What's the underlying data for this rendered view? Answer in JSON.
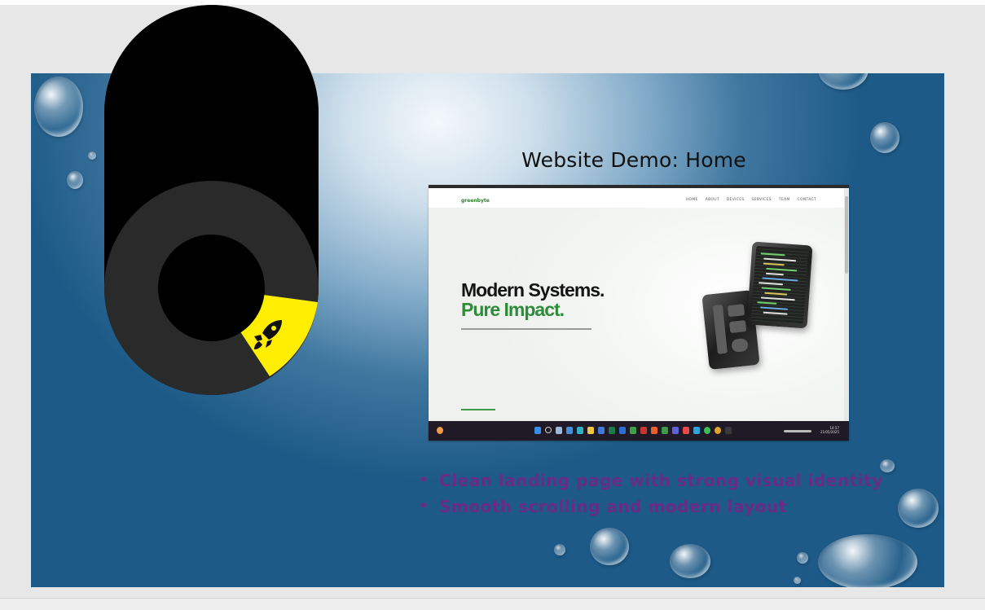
{
  "slide": {
    "title": "Website Demo: Home",
    "bullets": [
      "Clean landing page with strong visual identity",
      "Smooth scrolling and modern layout"
    ],
    "bullet_color": "#6a2c86"
  },
  "embedded_screenshot": {
    "logo": "greenbyte",
    "menu": [
      "HOME",
      "ABOUT",
      "DEVICES",
      "SERVICES",
      "TEAM",
      "CONTACT"
    ],
    "hero_line1": "Modern Systems.",
    "hero_line2": "Pure Impact.",
    "hero_accent_color": "#2e8b3a",
    "taskbar_clock": [
      "14:57",
      "21/05/2025"
    ]
  },
  "overlay_widget": {
    "icon": "rocket-icon",
    "segment_color": "#ffee00",
    "background": "#000000"
  }
}
